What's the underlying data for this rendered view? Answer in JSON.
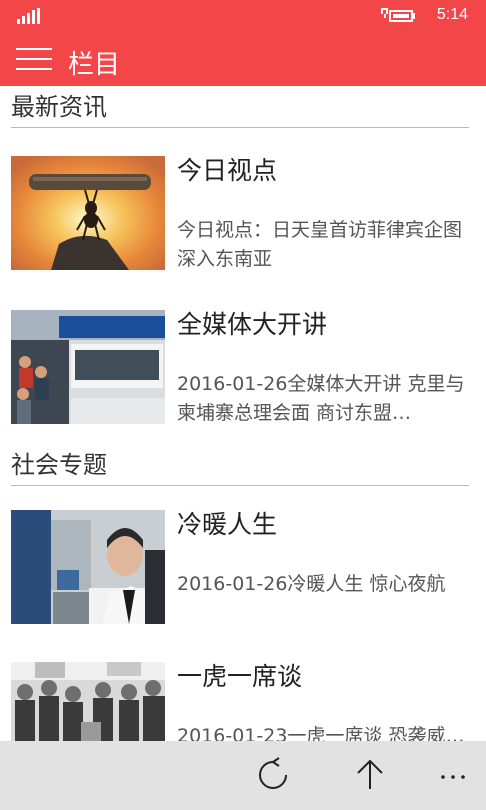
{
  "status_bar": {
    "time": "5:14",
    "signal_icon": "signal-bars-icon",
    "battery_icon": "battery-charging-icon"
  },
  "header": {
    "title": "栏目",
    "menu_icon": "hamburger-menu-icon",
    "background": "#f24648"
  },
  "sections": [
    {
      "title": "最新资讯",
      "items": [
        {
          "title": "今日视点",
          "summary": "今日视点：日天皇首访菲律宾企图深入东南亚",
          "thumbnail": "ant-lifting-log-sunset-photo"
        },
        {
          "title": "全媒体大开讲",
          "summary": "2016-01-26全媒体大开讲 克里与柬埔寨总理会面 商讨东盟…",
          "thumbnail": "medical-insurance-office-photo"
        }
      ]
    },
    {
      "title": "社会专题",
      "items": [
        {
          "title": "冷暖人生",
          "summary": "2016-01-26冷暖人生 惊心夜航",
          "thumbnail": "pilot-in-cabin-photo"
        },
        {
          "title": "一虎一席谈",
          "summary": "2016-01-23一虎一席谈 恐袭威…",
          "thumbnail": "protest-crowd-photo"
        }
      ]
    }
  ],
  "command_bar": {
    "icons": [
      "refresh-icon",
      "arrow-up-icon",
      "more-icon"
    ],
    "background": "#e2e2e2"
  }
}
